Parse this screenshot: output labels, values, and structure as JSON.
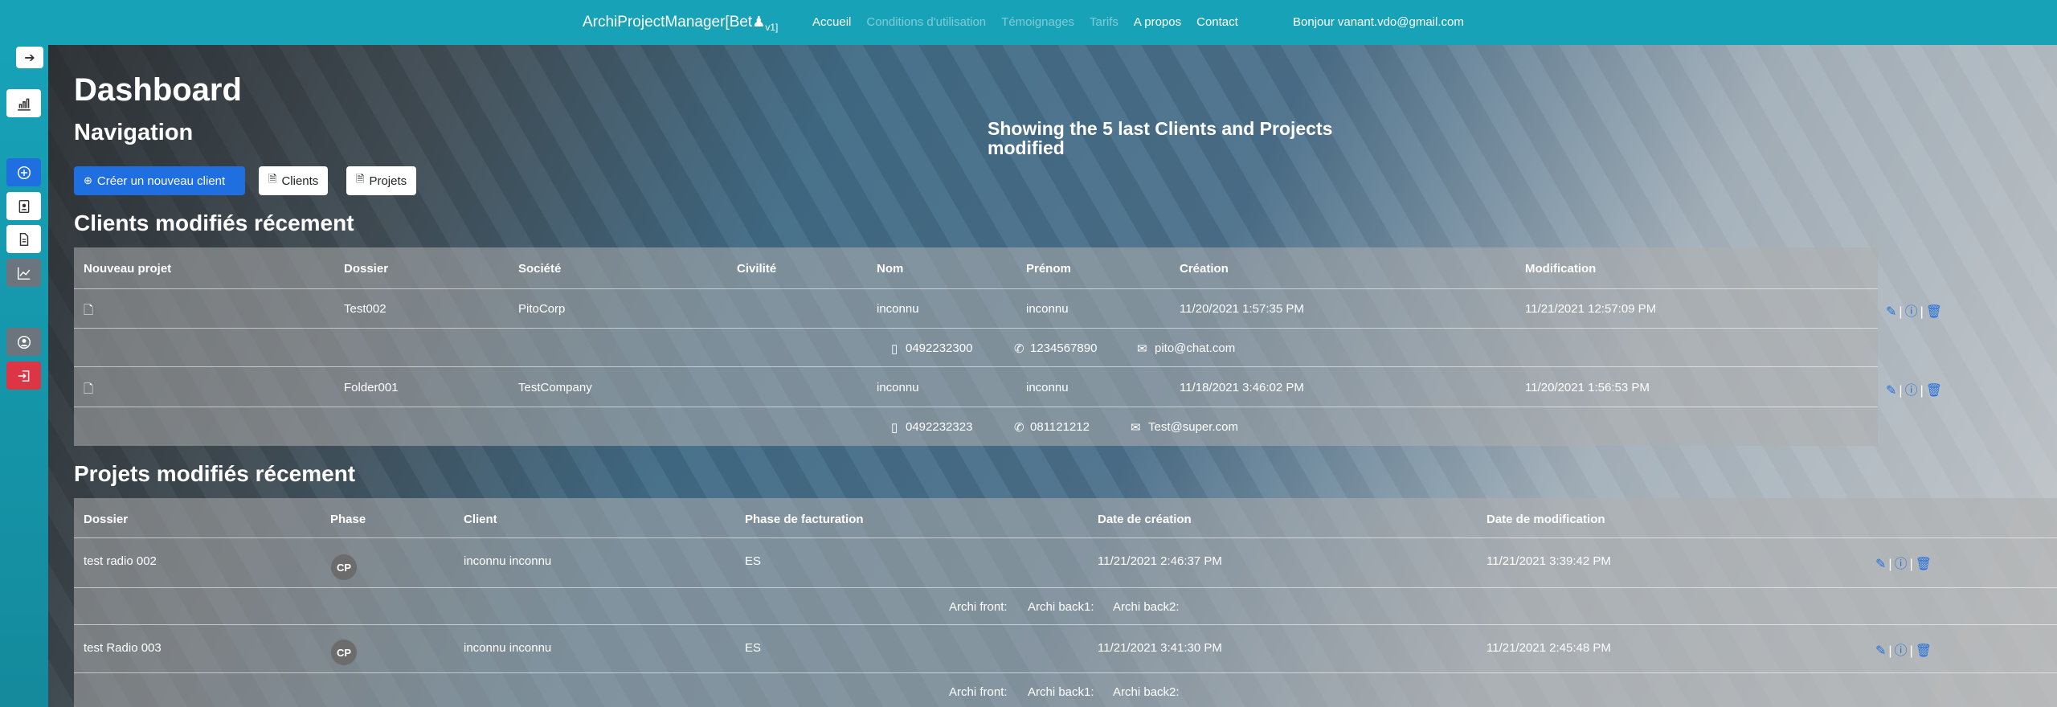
{
  "navbar": {
    "brand": "ArchiProjectManager[Bet",
    "brand_sub": "v1]",
    "items": [
      {
        "label": "Accueil",
        "disabled": false
      },
      {
        "label": "Conditions d'utilisation",
        "disabled": true
      },
      {
        "label": "Témoignages",
        "disabled": true
      },
      {
        "label": "Tarifs",
        "disabled": true
      },
      {
        "label": "A propos",
        "disabled": false
      },
      {
        "label": "Contact",
        "disabled": false
      }
    ],
    "greeting": "Bonjour vanant.vdo@gmail.com"
  },
  "sidebar": {
    "icons": [
      "collapse-arrow-icon",
      "chart-icon",
      "plus-circle-icon",
      "client-file-icon",
      "document-icon",
      "graph-icon",
      "user-circle-icon",
      "logout-icon"
    ]
  },
  "page": {
    "title": "Dashboard",
    "subtitle": "Navigation",
    "showing": "Showing the 5 last Clients and Projects modified"
  },
  "buttons": {
    "new_client": "Créer un nouveau client",
    "clients": "Clients",
    "projects": "Projets"
  },
  "clients": {
    "title": "Clients modifiés récement",
    "headers": [
      "Nouveau projet",
      "Dossier",
      "Société",
      "Civilité",
      "Nom",
      "Prénom",
      "Création",
      "Modification"
    ],
    "rows": [
      {
        "dossier": "Test002",
        "societe": "PitoCorp",
        "civilite": "",
        "nom": "inconnu",
        "prenom": "inconnu",
        "creation": "11/20/2021 1:57:35 PM",
        "modification": "11/21/2021 12:57:09 PM",
        "mobile": "0492232300",
        "phone": "1234567890",
        "email": "pito@chat.com"
      },
      {
        "dossier": "Folder001",
        "societe": "TestCompany",
        "civilite": "",
        "nom": "inconnu",
        "prenom": "inconnu",
        "creation": "11/18/2021 3:46:02 PM",
        "modification": "11/20/2021 1:56:53 PM",
        "mobile": "0492232323",
        "phone": "081121212",
        "email": "Test@super.com"
      }
    ]
  },
  "projects": {
    "title": "Projets modifiés récement",
    "headers": [
      "Dossier",
      "Phase",
      "Client",
      "Phase de facturation",
      "Date de création",
      "Date de modification"
    ],
    "rows": [
      {
        "dossier": "test radio 002",
        "phase": "CP",
        "client": "inconnu inconnu",
        "facturation": "ES",
        "creation": "11/21/2021 2:46:37 PM",
        "modification": "11/21/2021 3:39:42 PM",
        "archi_front": "Archi front:",
        "archi_back1": "Archi back1:",
        "archi_back2": "Archi back2:"
      },
      {
        "dossier": "test Radio 003",
        "phase": "CP",
        "client": "inconnu inconnu",
        "facturation": "ES",
        "creation": "11/21/2021 3:41:30 PM",
        "modification": "11/21/2021 2:45:48 PM",
        "archi_front": "Archi front:",
        "archi_back1": "Archi back1:",
        "archi_back2": "Archi back2:"
      }
    ]
  }
}
